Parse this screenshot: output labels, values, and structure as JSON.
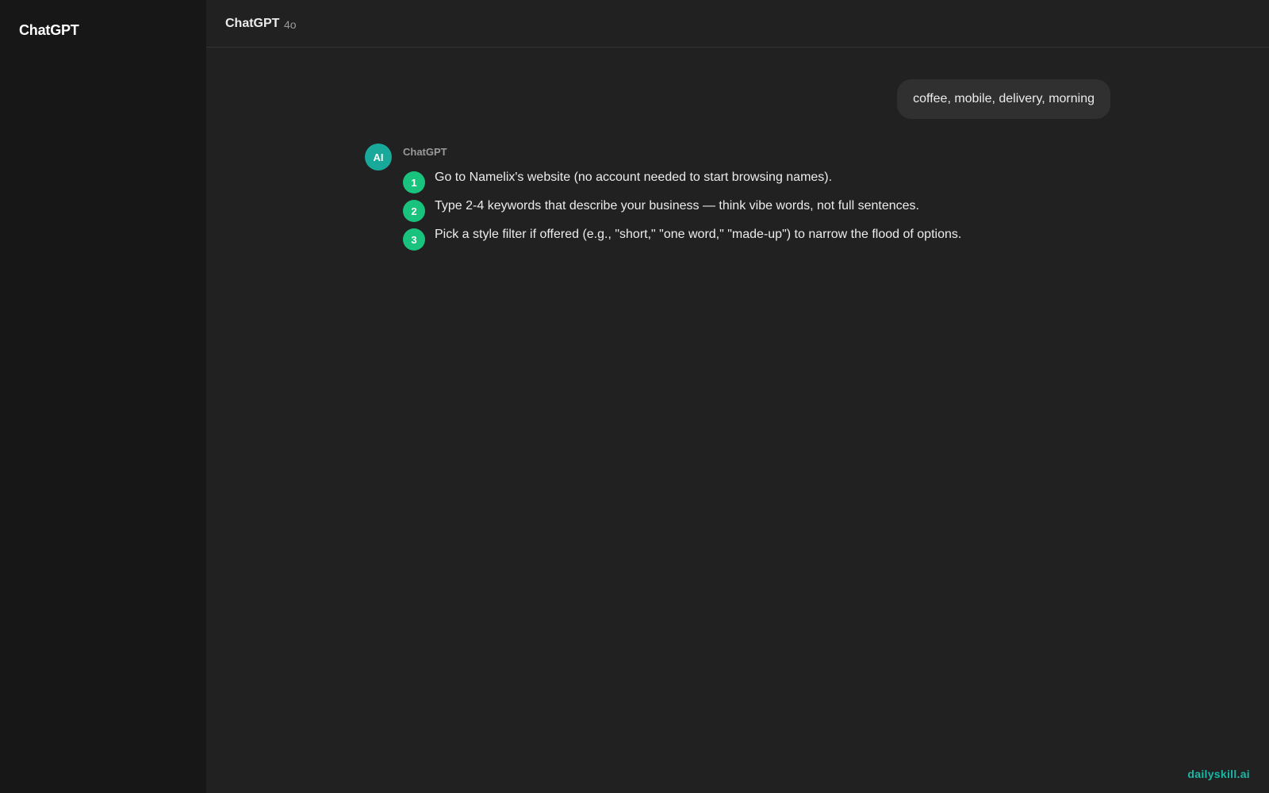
{
  "sidebar": {
    "brand": "ChatGPT"
  },
  "header": {
    "title": "ChatGPT",
    "model": "4o"
  },
  "conversation": {
    "user_message": "coffee, mobile, delivery, morning",
    "assistant": {
      "avatar_label": "AI",
      "name": "ChatGPT",
      "steps": [
        {
          "number": "1",
          "text": "Go to Namelix's website (no account needed to start browsing names)."
        },
        {
          "number": "2",
          "text": "Type 2-4 keywords that describe your business — think vibe words, not full sentences."
        },
        {
          "number": "3",
          "text": "Pick a style filter if offered (e.g., \"short,\" \"one word,\" \"made-up\") to narrow the flood of options."
        }
      ]
    }
  },
  "watermark": "dailyskill.ai",
  "colors": {
    "background": "#212121",
    "sidebar": "#171717",
    "user_bubble": "#303030",
    "avatar": "#19a99a",
    "step_badge": "#19c37d",
    "watermark": "#19b8a6"
  }
}
